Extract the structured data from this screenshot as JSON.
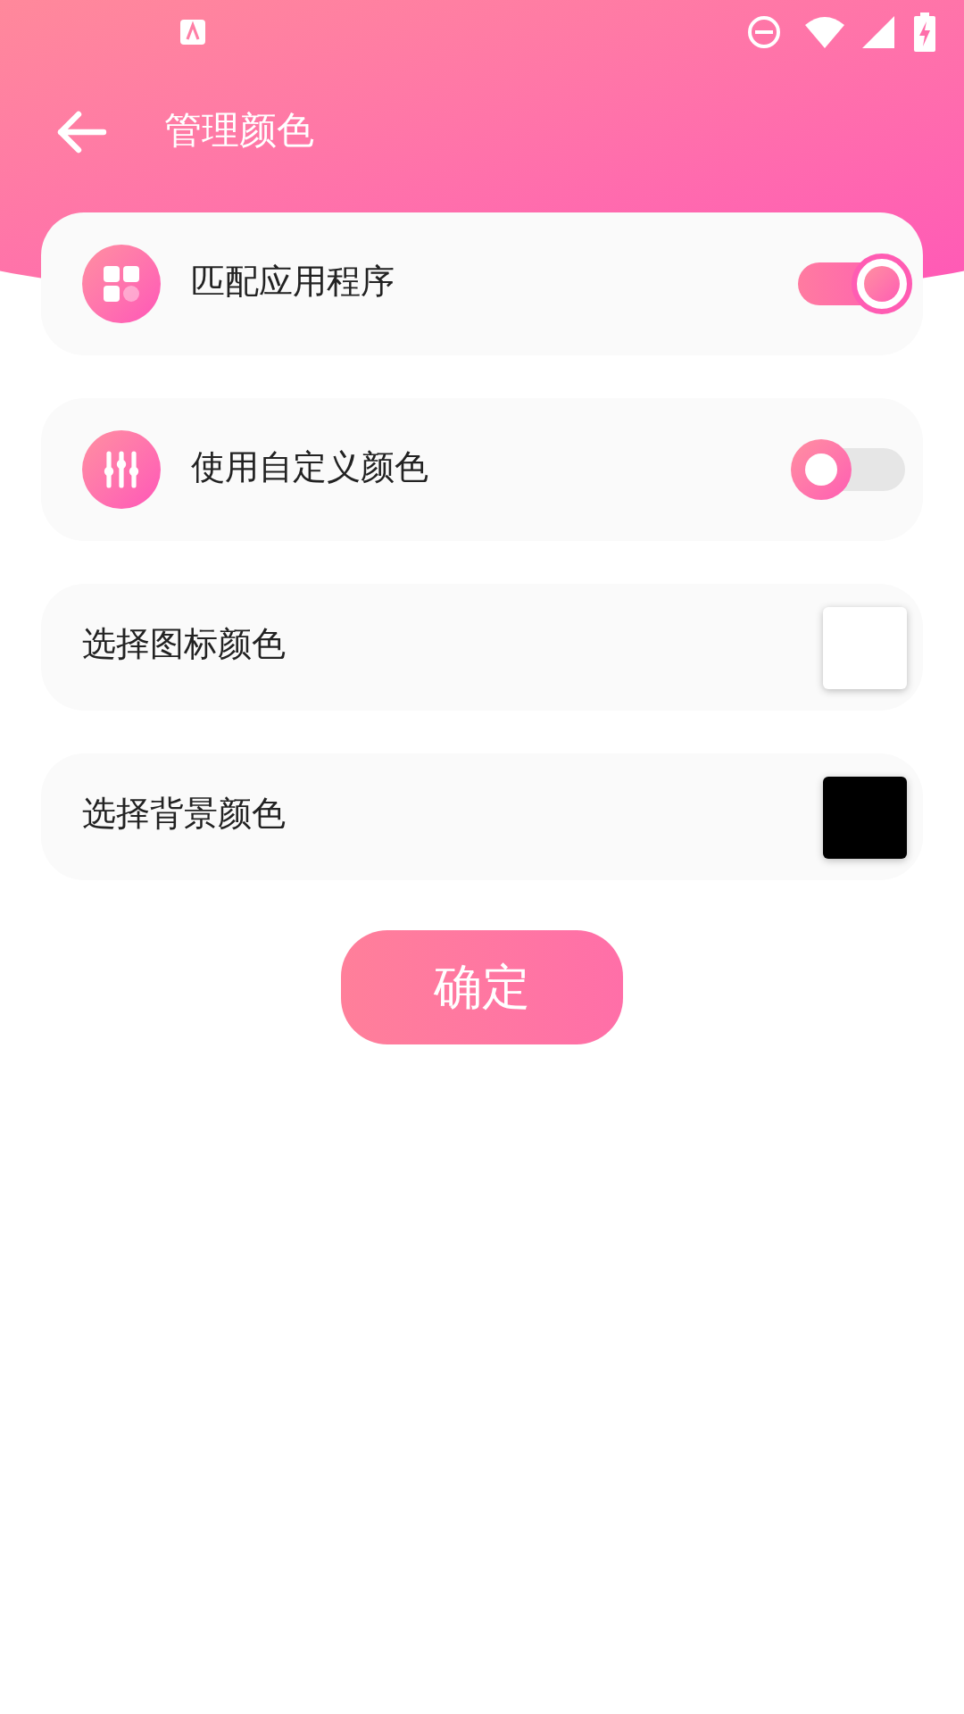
{
  "app_bar": {
    "title": "管理颜色"
  },
  "settings": [
    {
      "kind": "switch",
      "label": "匹配应用程序",
      "on": true
    },
    {
      "kind": "switch",
      "label": "使用自定义颜色",
      "on": false
    },
    {
      "kind": "color",
      "label": "选择图标颜色",
      "color": "#ffffff"
    },
    {
      "kind": "color",
      "label": "选择背景颜色",
      "color": "#000000"
    }
  ],
  "confirm_button": "确定"
}
